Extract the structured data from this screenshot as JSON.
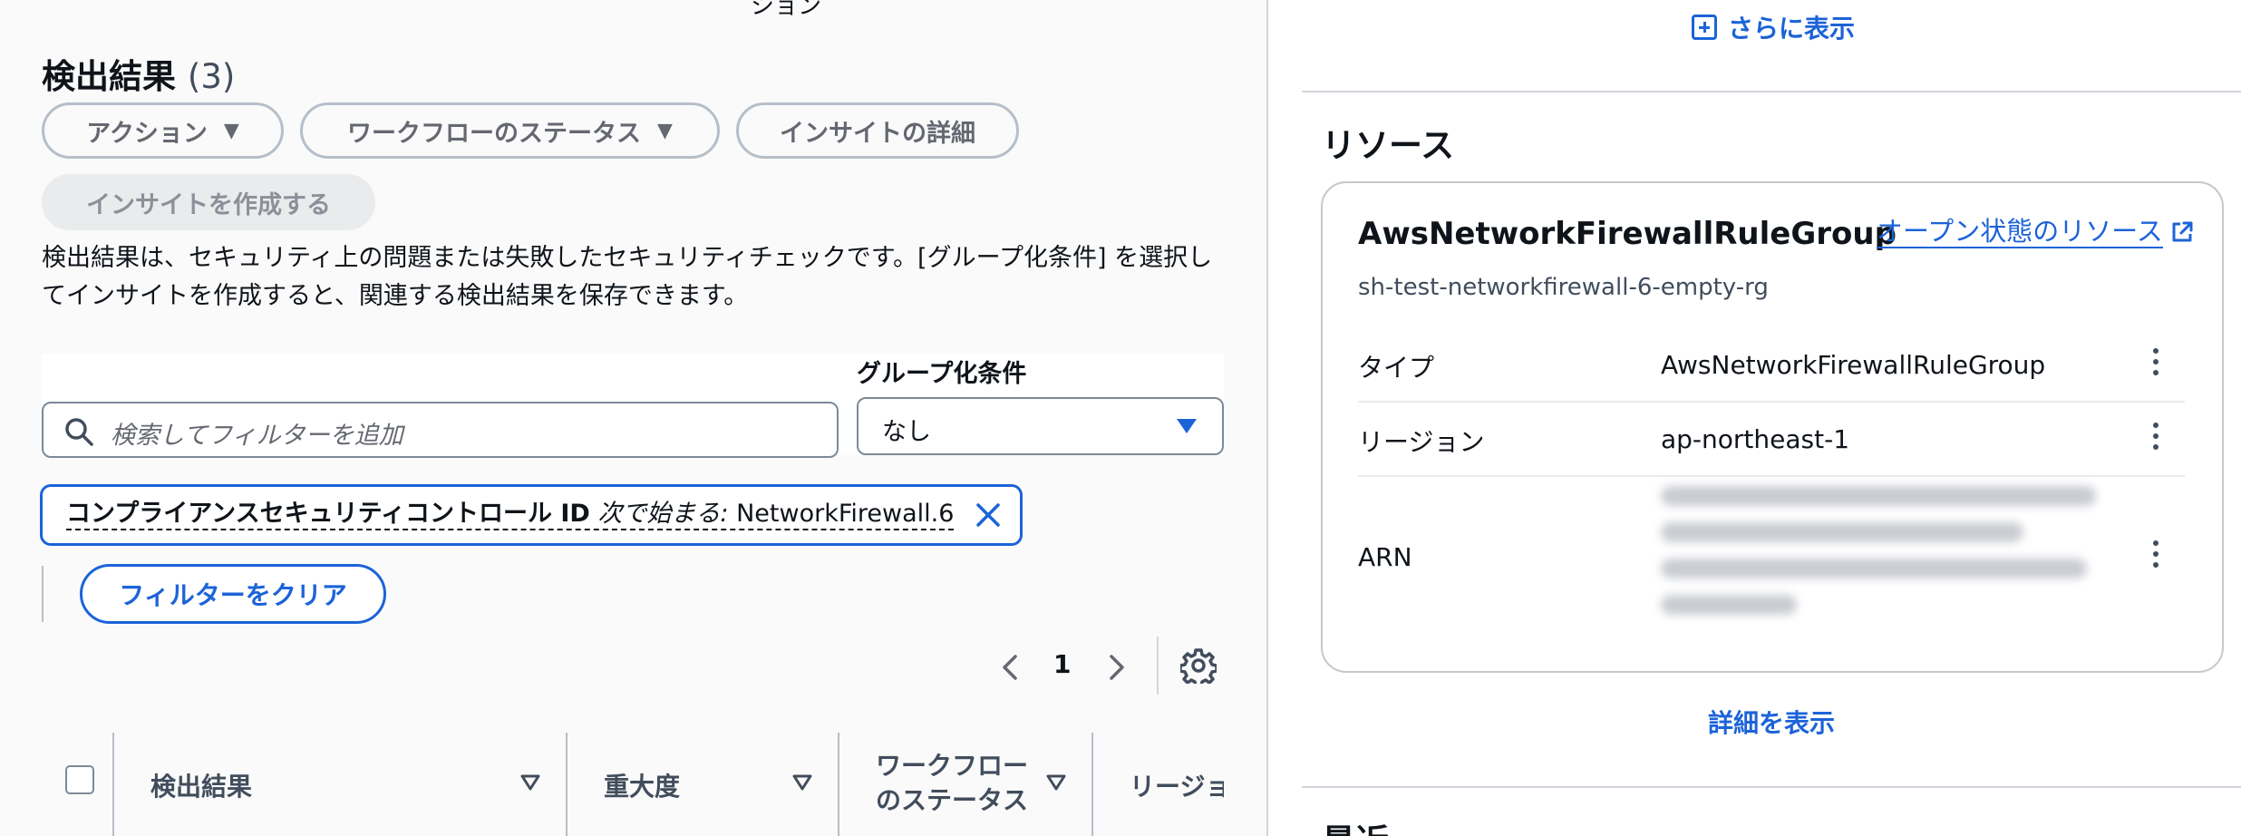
{
  "top_cut_text": "ション",
  "findings": {
    "title": "検出結果",
    "count": "(3)",
    "buttons": {
      "actions": "アクション",
      "workflow_status": "ワークフローのステータス",
      "insight_details": "インサイトの詳細",
      "create_insight": "インサイトを作成する"
    },
    "description": "検出結果は、セキュリティ上の問題または失敗したセキュリティチェックです。[グループ化条件] を選択してインサイトを作成すると、関連する検出結果を保存できます。",
    "search_placeholder": "検索してフィルターを追加",
    "group_by_label": "グループ化条件",
    "group_by_value": "なし",
    "filter_token": {
      "property": "コンプライアンスセキュリティコントロール ID",
      "operator": "次で始まる:",
      "value": "NetworkFirewall.6"
    },
    "clear_filters": "フィルターをクリア",
    "page": "1",
    "columns": [
      "検出結果",
      "重大度",
      "ワークフロー",
      "のステータス",
      "リージョ"
    ]
  },
  "right_panel": {
    "show_more": "さらに表示",
    "resources_title": "リソース",
    "resource": {
      "type_name": "AwsNetworkFirewallRuleGroup",
      "open_link": "オープン状態のリソース",
      "id": "sh-test-networkfirewall-6-empty-rg",
      "rows": [
        {
          "label": "タイプ",
          "value": "AwsNetworkFirewallRuleGroup"
        },
        {
          "label": "リージョン",
          "value": "ap-northeast-1"
        },
        {
          "label": "ARN",
          "value": ""
        }
      ]
    },
    "view_details": "詳細を表示",
    "next_section_cut": "最近"
  },
  "colors": {
    "link_blue": "#1c63d8",
    "border_gray": "#b6bec9",
    "text_dark": "#0f141a"
  }
}
